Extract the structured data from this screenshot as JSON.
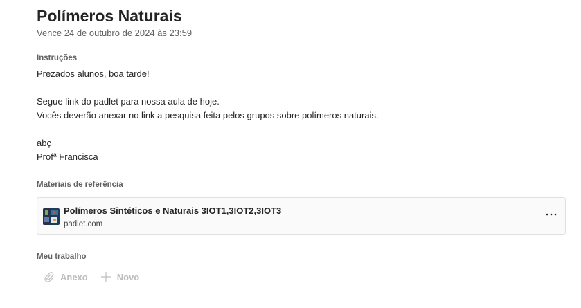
{
  "assignment": {
    "title": "Polímeros Naturais",
    "due": "Vence 24 de outubro de 2024 às 23:59"
  },
  "instructions": {
    "label": "Instruções",
    "lines": [
      "Prezados alunos, boa tarde!",
      "",
      "Segue link do padlet para nossa aula de hoje.",
      "Vocês deverão anexar no link a pesquisa feita pelos grupos sobre polímeros naturais.",
      "",
      "abç",
      "Profª Francisca"
    ]
  },
  "reference": {
    "label": "Materiais de referência",
    "item": {
      "title": "Polímeros Sintéticos e Naturais 3IOT1,3IOT2,3IOT3",
      "domain": "padlet.com",
      "more_label": "···"
    }
  },
  "work": {
    "label": "Meu trabalho",
    "attach_label": "Anexo",
    "new_label": "Novo"
  },
  "icons": {
    "thumbnail": "padlet-thumbnail-icon",
    "more": "more-options-icon",
    "attach": "paperclip-icon",
    "new": "plus-icon"
  },
  "colors": {
    "text_primary": "#242424",
    "text_secondary": "#616161",
    "disabled": "#bdbdbd",
    "card_border": "#e0e0e0",
    "card_background": "#fafafa"
  }
}
